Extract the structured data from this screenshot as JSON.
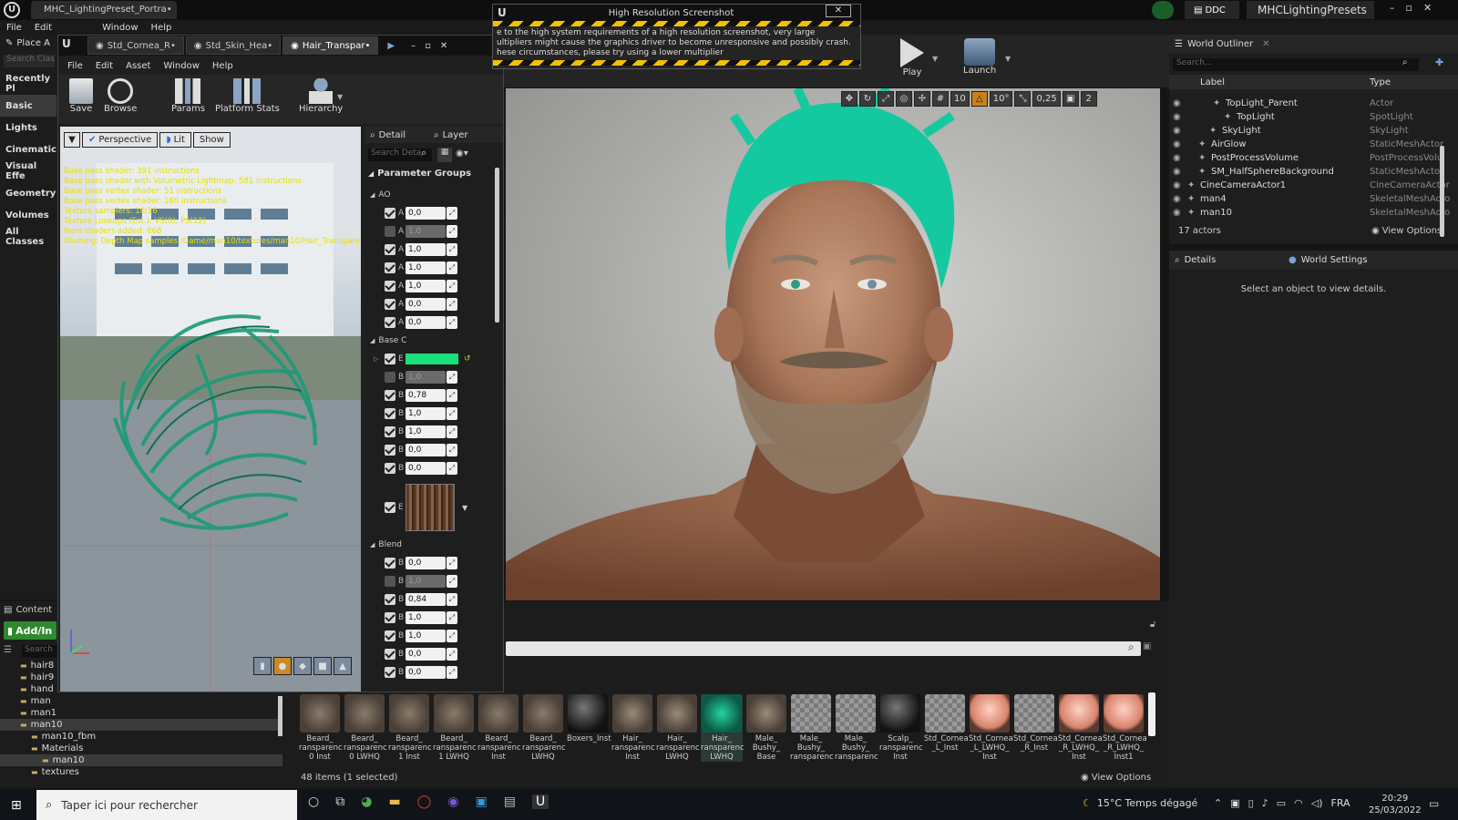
{
  "main_window": {
    "project_tab": "MHC_LightingPreset_Portra•",
    "menu": [
      "File",
      "Edit",
      "Window",
      "Help"
    ],
    "ddc_label": "DDC",
    "project_name": "MHCLightingPresets",
    "place_actors": "Place A",
    "search_classes_placeholder": "Search Clas",
    "modes": [
      "Recently Pl",
      "Basic",
      "Lights",
      "Cinematic",
      "Visual Effe",
      "Geometry",
      "Volumes",
      "All Classes"
    ],
    "toolbar": {
      "play": "Play",
      "launch": "Launch"
    }
  },
  "hires_dialog": {
    "title": "High Resolution Screenshot",
    "lines": [
      "e to the high system requirements of a high resolution screenshot, very large",
      "ultipliers might cause the graphics driver to become unresponsive and possibly crash.",
      "hese circumstances, please try using a lower multiplier"
    ],
    "close": "✕"
  },
  "material_editor": {
    "tabs": [
      "Std_Cornea_R•",
      "Std_Skin_Hea•",
      "Hair_Transpar•"
    ],
    "menu": [
      "File",
      "Edit",
      "Asset",
      "Window",
      "Help"
    ],
    "toolbar": [
      "Save",
      "Browse",
      "Params",
      "Platform Stats",
      "Hierarchy"
    ],
    "viewport_buttons": {
      "perspective": "Perspective",
      "lit": "Lit",
      "show": "Show"
    },
    "stats": [
      "Base pass shader: 391 instructions",
      "Base pass shader with Volumetric Lightmap: 581 instructions",
      "Base pass vertex shader: 51 instructions",
      "Base pass vertex shader: 160 instructions",
      "Texture samplers: 10/16",
      "Texture Lookups (Est.): VS(0), PS(12)",
      "Num shaders added: 868",
      "Warning: Depth Map samples /Game/man10/textures/man10/Hair_Transparen"
    ],
    "panel_tabs": {
      "detail": "Detail",
      "layer": "Layer"
    },
    "search_placeholder": "Search Deta",
    "parameter_groups": "Parameter Groups",
    "groups": {
      "ao": {
        "name": "AO",
        "rows": [
          {
            "label": "A",
            "value": "0,0",
            "enabled": true
          },
          {
            "label": "A",
            "value": "1,0",
            "enabled": false
          },
          {
            "label": "A",
            "value": "1,0",
            "enabled": true
          },
          {
            "label": "A",
            "value": "1,0",
            "enabled": true
          },
          {
            "label": "A",
            "value": "1,0",
            "enabled": true
          },
          {
            "label": "A",
            "value": "0,0",
            "enabled": true
          },
          {
            "label": "A",
            "value": "0,0",
            "enabled": true
          }
        ]
      },
      "base": {
        "name": "Base C",
        "color_label": "E",
        "color": "#19e07a",
        "rows": [
          {
            "label": "B",
            "value": "1,0",
            "enabled": false
          },
          {
            "label": "B",
            "value": "0,78",
            "enabled": true
          },
          {
            "label": "B",
            "value": "1,0",
            "enabled": true
          },
          {
            "label": "B",
            "value": "1,0",
            "enabled": true
          },
          {
            "label": "B",
            "value": "0,0",
            "enabled": true
          },
          {
            "label": "B",
            "value": "0,0",
            "enabled": true
          }
        ],
        "texture_label": "E"
      },
      "blend": {
        "name": "Blend",
        "rows": [
          {
            "label": "B",
            "value": "0,0",
            "enabled": true
          },
          {
            "label": "B",
            "value": "1,0",
            "enabled": false
          },
          {
            "label": "B",
            "value": "0,84",
            "enabled": true
          },
          {
            "label": "B",
            "value": "1,0",
            "enabled": true
          },
          {
            "label": "B",
            "value": "1,0",
            "enabled": true
          },
          {
            "label": "B",
            "value": "0,0",
            "enabled": true
          },
          {
            "label": "B",
            "value": "0,0",
            "enabled": true
          }
        ]
      }
    }
  },
  "viewport_toolbar": {
    "grid": "10",
    "rot": "10°",
    "scale": "0,25",
    "cam": "2"
  },
  "world_outliner": {
    "title": "World Outliner",
    "search_placeholder": "Search...",
    "col_label": "Label",
    "col_type": "Type",
    "items": [
      {
        "name": "TopLight_Parent",
        "type": "Actor",
        "indent": 62
      },
      {
        "name": "TopLight",
        "type": "SpotLight",
        "indent": 74
      },
      {
        "name": "SkyLight",
        "type": "SkyLight",
        "indent": 58
      },
      {
        "name": "AirGlow",
        "type": "StaticMeshActor",
        "indent": 46
      },
      {
        "name": "PostProcessVolume",
        "type": "PostProcessVolu",
        "indent": 46
      },
      {
        "name": "SM_HalfSphereBackground",
        "type": "StaticMeshActor",
        "indent": 46
      },
      {
        "name": "CineCameraActor1",
        "type": "CineCameraActor",
        "indent": 34
      },
      {
        "name": "man4",
        "type": "SkeletalMeshActo",
        "indent": 34
      },
      {
        "name": "man10",
        "type": "SkeletalMeshActo",
        "indent": 34
      }
    ],
    "count": "17 actors",
    "view_options": "View Options"
  },
  "details_panel": {
    "tab_details": "Details",
    "tab_world": "World Settings",
    "empty_msg": "Select an object to view details."
  },
  "content_browser": {
    "tab": "Content",
    "add_import": "Add/In",
    "search_placeholder": "Search",
    "folders": [
      {
        "name": "hair8",
        "indent": 22
      },
      {
        "name": "hair9",
        "indent": 22
      },
      {
        "name": "hand",
        "indent": 22
      },
      {
        "name": "man",
        "indent": 22
      },
      {
        "name": "man1",
        "indent": 22
      },
      {
        "name": "man10",
        "indent": 22
      },
      {
        "name": "man10_fbm",
        "indent": 34
      },
      {
        "name": "Materials",
        "indent": 34
      },
      {
        "name": "man10",
        "indent": 46
      },
      {
        "name": "textures",
        "indent": 34
      }
    ],
    "assets": [
      {
        "label": "Beard_\nransparenc\n0 Inst",
        "kind": "beard"
      },
      {
        "label": "Beard_\nransparenc\n0 LWHQ",
        "kind": "beard"
      },
      {
        "label": "Beard_\nransparenc\n1 Inst",
        "kind": "beard"
      },
      {
        "label": "Beard_\nransparenc\n1 LWHQ",
        "kind": "beard"
      },
      {
        "label": "Beard_\nransparenc\nInst",
        "kind": "beard"
      },
      {
        "label": "Beard_\nransparenc\nLWHQ",
        "kind": "beard"
      },
      {
        "label": "Boxers_Inst",
        "kind": "dark"
      },
      {
        "label": "Hair_\nransparenc\nInst",
        "kind": "hair"
      },
      {
        "label": "Hair_\nransparenc\nLWHQ",
        "kind": "hair"
      },
      {
        "label": "Hair_\nransparenc\nLWHQ",
        "kind": "green"
      },
      {
        "label": "Male_\nBushy_\nBase",
        "kind": "hair"
      },
      {
        "label": "Male_\nBushy_\nransparenc",
        "kind": "check"
      },
      {
        "label": "Male_\nBushy_\nransparenc",
        "kind": "check"
      },
      {
        "label": "Scalp_\nransparenc\nInst",
        "kind": "dark"
      },
      {
        "label": "Std_Cornea\n_L_Inst",
        "kind": "check"
      },
      {
        "label": "Std_Cornea\n_L_LWHQ_\nInst",
        "kind": "eye"
      },
      {
        "label": "Std_Cornea\n_R_Inst",
        "kind": "check"
      },
      {
        "label": "Std_Cornea\n_R_LWHQ_\nInst",
        "kind": "eye"
      },
      {
        "label": "Std_Cornea\n_R_LWHQ_\nInst1",
        "kind": "eye"
      }
    ],
    "status": "48 items (1 selected)",
    "view_options": "View Options"
  },
  "taskbar": {
    "search_placeholder": "Taper ici pour rechercher",
    "weather": "15°C  Temps dégagé",
    "lang": "FRA",
    "time": "20:29",
    "date": "25/03/2022"
  }
}
